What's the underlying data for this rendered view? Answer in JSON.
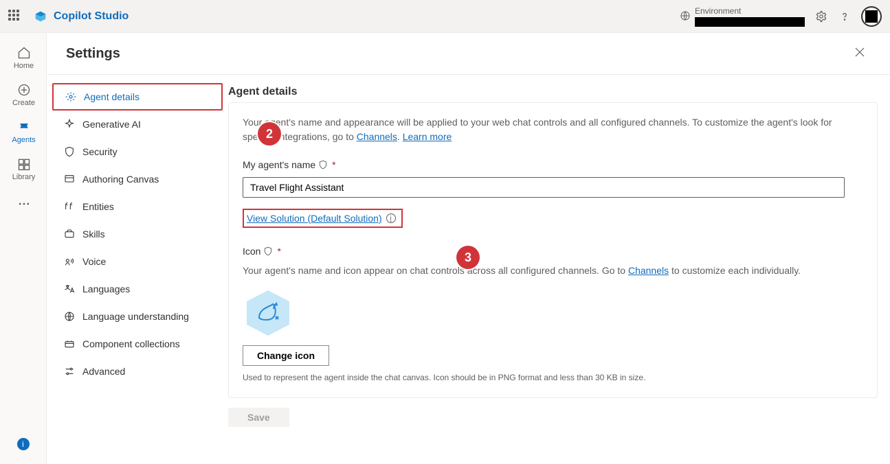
{
  "app_title": "Copilot Studio",
  "environment_label": "Environment",
  "page_title": "Settings",
  "rail": {
    "home": "Home",
    "create": "Create",
    "agents": "Agents",
    "library": "Library"
  },
  "sidebar": [
    {
      "label": "Agent details"
    },
    {
      "label": "Generative AI"
    },
    {
      "label": "Security"
    },
    {
      "label": "Authoring Canvas"
    },
    {
      "label": "Entities"
    },
    {
      "label": "Skills"
    },
    {
      "label": "Voice"
    },
    {
      "label": "Languages"
    },
    {
      "label": "Language understanding"
    },
    {
      "label": "Component collections"
    },
    {
      "label": "Advanced"
    }
  ],
  "section_title": "Agent details",
  "description_prefix": "Your agent's name and appearance will be applied to your web chat controls and all configured channels. To customize the agent's look for specific integrations, go to ",
  "channels_link": "Channels",
  "description_period": ". ",
  "learn_more": "Learn more",
  "name_label": "My agent's name",
  "agent_name_value": "Travel Flight Assistant",
  "solution_link": "View Solution (Default Solution)",
  "icon_label": "Icon",
  "icon_desc_prefix": "Your agent's name and icon appear on chat controls across all configured channels. Go to ",
  "icon_desc_suffix": " to customize each individually.",
  "change_icon_label": "Change icon",
  "icon_hint": "Used to represent the agent inside the chat canvas. Icon should be in PNG format and less than 30 KB in size.",
  "save_label": "Save",
  "annot": {
    "two": "2",
    "three": "3"
  }
}
